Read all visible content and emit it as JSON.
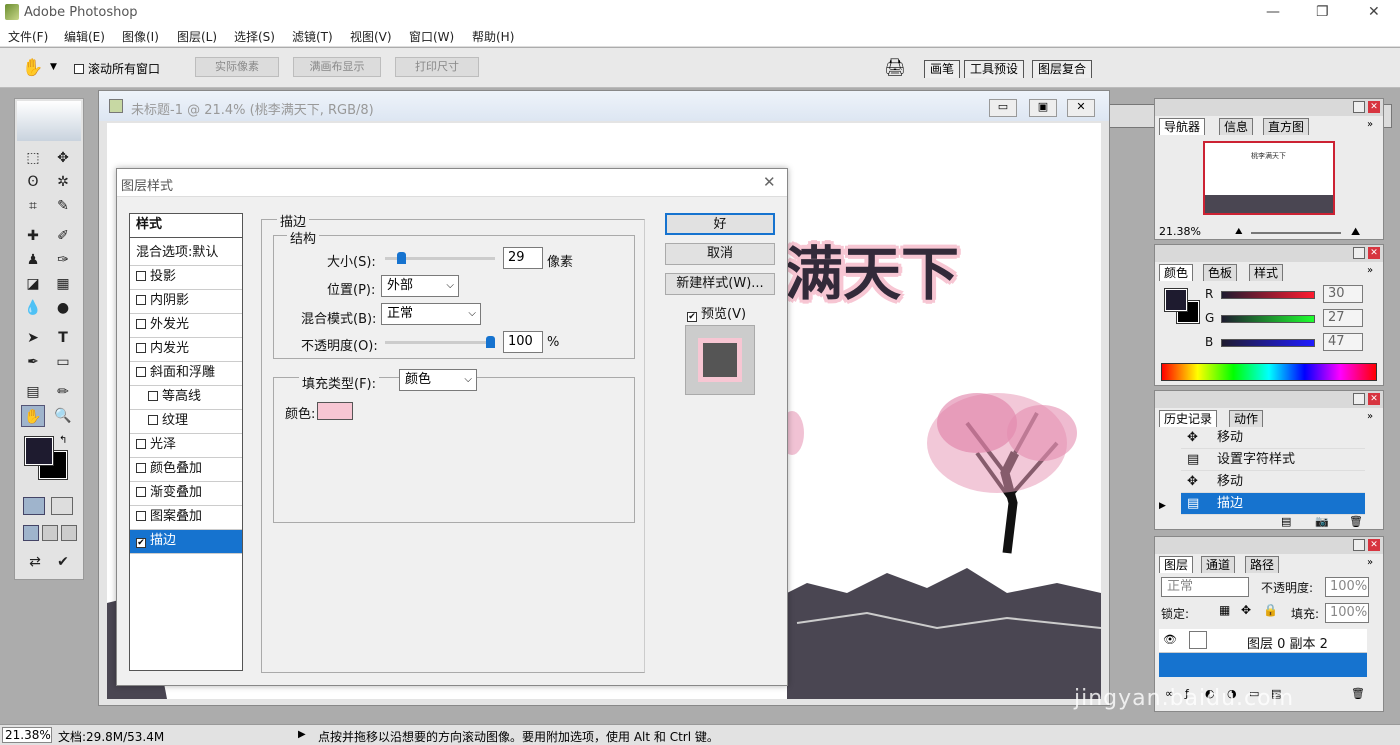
{
  "app": {
    "title": "Adobe Photoshop"
  },
  "menu": [
    "文件(F)",
    "编辑(E)",
    "图像(I)",
    "图层(L)",
    "选择(S)",
    "滤镜(T)",
    "视图(V)",
    "窗口(W)",
    "帮助(H)"
  ],
  "options": {
    "scroll_all": "滚动所有窗口",
    "actual_pixels": "实际像素",
    "fit_screen": "满画布显示",
    "print_size": "打印尺寸"
  },
  "well_tabs": [
    "画笔",
    "工具预设",
    "图层复合"
  ],
  "document": {
    "title": "未标题-1 @ 21.4% (桃李满天下, RGB/8)",
    "canvas_text": "满天下"
  },
  "dialog": {
    "title": "图层样式",
    "styles_header": "样式",
    "styles": [
      "混合选项:默认",
      "投影",
      "内阴影",
      "外发光",
      "内发光",
      "斜面和浮雕",
      "等高线",
      "纹理",
      "光泽",
      "颜色叠加",
      "渐变叠加",
      "图案叠加",
      "描边"
    ],
    "selected_style": "描边",
    "section_title": "描边",
    "structure_title": "结构",
    "size_label": "大小(S):",
    "size_value": "29",
    "size_unit": "像素",
    "size_fraction": 0.12,
    "position_label": "位置(P):",
    "position_value": "外部",
    "blend_label": "混合模式(B):",
    "blend_value": "正常",
    "opacity_label": "不透明度(O):",
    "opacity_value": "100",
    "opacity_unit": "%",
    "opacity_fraction": 1.0,
    "fill_type_label": "填充类型(F):",
    "fill_type_value": "颜色",
    "color_label": "颜色:",
    "stroke_color": "#f7c6d3",
    "ok": "好",
    "cancel": "取消",
    "new_style": "新建样式(W)...",
    "preview": "预览(V)"
  },
  "navigator": {
    "tabs": [
      "导航器",
      "信息",
      "直方图"
    ],
    "zoom": "21.38%",
    "thumb_text": "桃李满天下"
  },
  "color_panel": {
    "tabs": [
      "颜色",
      "色板",
      "样式"
    ],
    "r_label": "R",
    "g_label": "G",
    "b_label": "B",
    "r": "30",
    "g": "27",
    "b": "47",
    "fg": "#1e1b2f",
    "bg": "#000000"
  },
  "history": {
    "tabs": [
      "历史记录",
      "动作"
    ],
    "items": [
      "移动",
      "设置字符样式",
      "移动",
      "描边"
    ],
    "selected": "描边"
  },
  "layers": {
    "tabs": [
      "图层",
      "通道",
      "路径"
    ],
    "mode": "正常",
    "opacity_label": "不透明度:",
    "opacity": "100%",
    "lock_label": "锁定:",
    "fill_label": "填充:",
    "fill": "100%",
    "layer_name": "图层 0 副本 2"
  },
  "status": {
    "zoom": "21.38%",
    "doc": "文档:29.8M/53.4M",
    "hint": "点按并拖移以沿想要的方向滚动图像。要用附加选项，使用 Alt 和 Ctrl 键。"
  },
  "watermark": "jingyan.baidu.com"
}
